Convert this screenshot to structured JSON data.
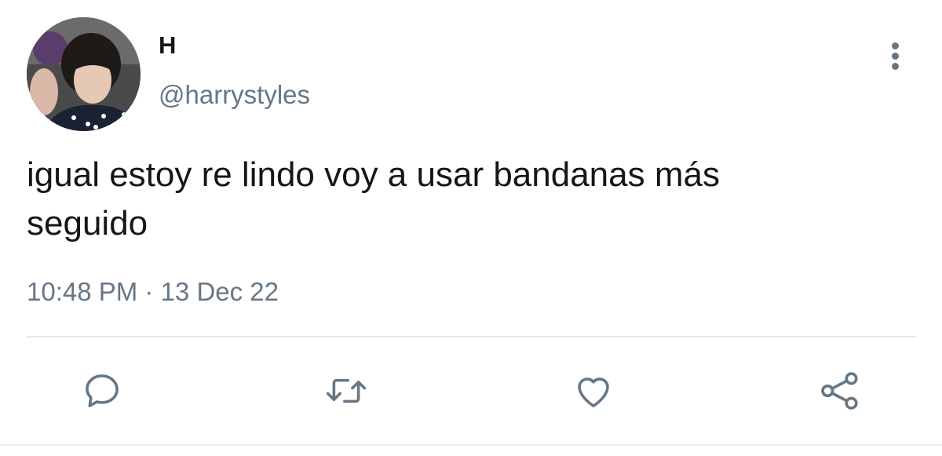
{
  "user": {
    "display_name": "H",
    "handle": "@harrystyles",
    "avatar_icon": "profile-photo"
  },
  "tweet": {
    "text_line1": "igual estoy re lindo voy a usar bandanas más",
    "text_line2": "seguido",
    "timestamp": "10:48 PM · 13 Dec 22"
  },
  "actions": {
    "reply_icon": "speech-bubble-icon",
    "retweet_icon": "retweet-arrows-icon",
    "like_icon": "heart-icon",
    "share_icon": "share-nodes-icon",
    "more_icon": "vertical-dots-icon"
  },
  "colors": {
    "text_primary": "#14171a",
    "text_secondary": "#657786",
    "divider": "#e1e8ed"
  }
}
